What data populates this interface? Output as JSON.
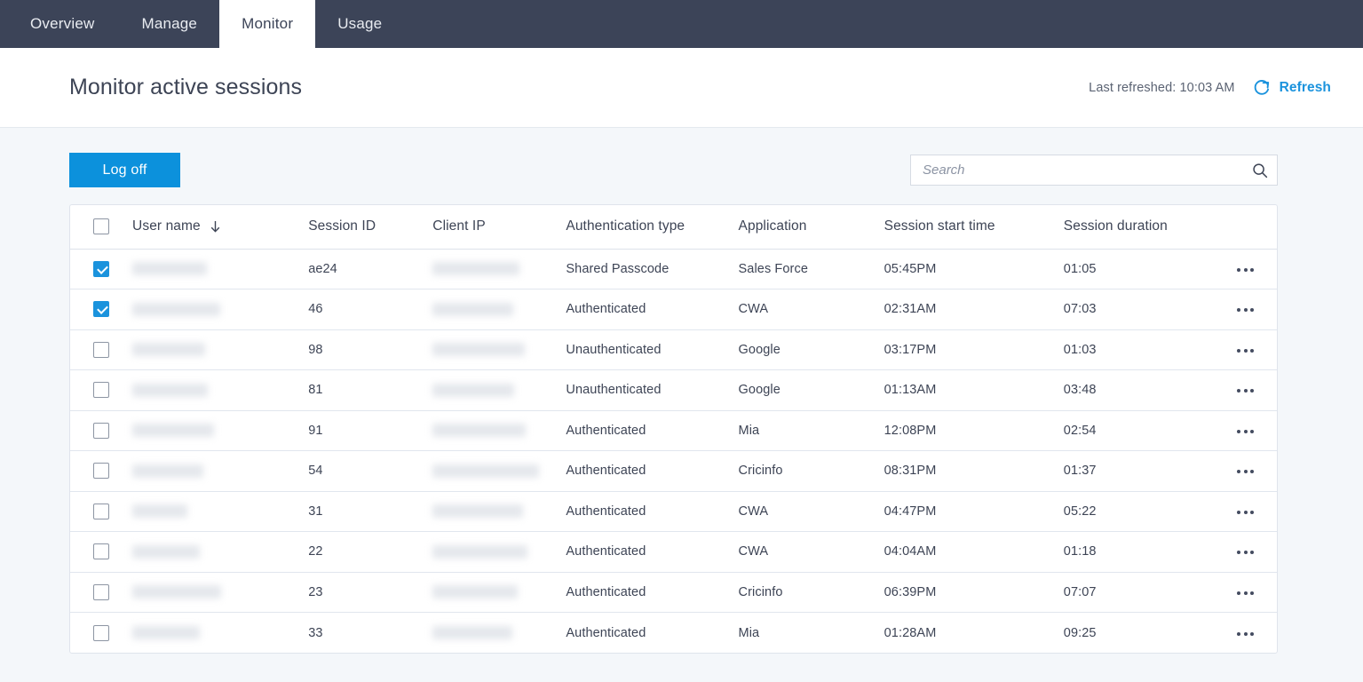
{
  "nav": {
    "tabs": [
      {
        "label": "Overview",
        "active": false
      },
      {
        "label": "Manage",
        "active": false
      },
      {
        "label": "Monitor",
        "active": true
      },
      {
        "label": "Usage",
        "active": false
      }
    ]
  },
  "header": {
    "title": "Monitor active sessions",
    "last_refreshed": "Last refreshed: 10:03 AM",
    "refresh_label": "Refresh",
    "refresh_icon": "refresh-circular-arrow-icon",
    "accent_color": "#1b93dd"
  },
  "toolbar": {
    "logoff_label": "Log off",
    "logoff_color": "#0c91dc",
    "search": {
      "placeholder": "Search",
      "value": "",
      "icon": "search-magnifier-icon"
    }
  },
  "table": {
    "select_all_checked": false,
    "sort_column": "User name",
    "sort_direction": "descending",
    "sort_icon": "arrow-down-icon",
    "row_menu_icon": "ellipsis-horizontal-icon",
    "columns": [
      "User name",
      "Session ID",
      "Client IP",
      "Authentication type",
      "Application",
      "Session start time",
      "Session duration"
    ],
    "rows": [
      {
        "selected": true,
        "user_name": "",
        "user_name_redacted": true,
        "user_redact_width": 84,
        "session_id": "ae24",
        "client_ip": "",
        "client_ip_redacted": true,
        "ip_redact_width": 98,
        "authentication_type": "Shared Passcode",
        "application": "Sales Force",
        "session_start_time": "05:45PM",
        "session_duration": "01:05"
      },
      {
        "selected": true,
        "user_name": "",
        "user_name_redacted": true,
        "user_redact_width": 99,
        "session_id": "46",
        "client_ip": "",
        "client_ip_redacted": true,
        "ip_redact_width": 91,
        "authentication_type": "Authenticated",
        "application": "CWA",
        "session_start_time": "02:31AM",
        "session_duration": "07:03"
      },
      {
        "selected": false,
        "user_name": "",
        "user_name_redacted": true,
        "user_redact_width": 82,
        "session_id": "98",
        "client_ip": "",
        "client_ip_redacted": true,
        "ip_redact_width": 104,
        "authentication_type": "Unauthenticated",
        "application": "Google",
        "session_start_time": "03:17PM",
        "session_duration": "01:03"
      },
      {
        "selected": false,
        "user_name": "",
        "user_name_redacted": true,
        "user_redact_width": 85,
        "session_id": "81",
        "client_ip": "",
        "client_ip_redacted": true,
        "ip_redact_width": 92,
        "authentication_type": "Unauthenticated",
        "application": "Google",
        "session_start_time": "01:13AM",
        "session_duration": "03:48"
      },
      {
        "selected": false,
        "user_name": "",
        "user_name_redacted": true,
        "user_redact_width": 92,
        "session_id": "91",
        "client_ip": "",
        "client_ip_redacted": true,
        "ip_redact_width": 105,
        "authentication_type": "Authenticated",
        "application": "Mia",
        "session_start_time": "12:08PM",
        "session_duration": "02:54"
      },
      {
        "selected": false,
        "user_name": "",
        "user_name_redacted": true,
        "user_redact_width": 80,
        "session_id": "54",
        "client_ip": "",
        "client_ip_redacted": true,
        "ip_redact_width": 120,
        "authentication_type": "Authenticated",
        "application": "Cricinfo",
        "session_start_time": "08:31PM",
        "session_duration": "01:37"
      },
      {
        "selected": false,
        "user_name": "",
        "user_name_redacted": true,
        "user_redact_width": 62,
        "session_id": "31",
        "client_ip": "",
        "client_ip_redacted": true,
        "ip_redact_width": 102,
        "authentication_type": "Authenticated",
        "application": "CWA",
        "session_start_time": "04:47PM",
        "session_duration": "05:22"
      },
      {
        "selected": false,
        "user_name": "",
        "user_name_redacted": true,
        "user_redact_width": 76,
        "session_id": "22",
        "client_ip": "",
        "client_ip_redacted": true,
        "ip_redact_width": 107,
        "authentication_type": "Authenticated",
        "application": "CWA",
        "session_start_time": "04:04AM",
        "session_duration": "01:18"
      },
      {
        "selected": false,
        "user_name": "",
        "user_name_redacted": true,
        "user_redact_width": 100,
        "session_id": "23",
        "client_ip": "",
        "client_ip_redacted": true,
        "ip_redact_width": 96,
        "authentication_type": "Authenticated",
        "application": "Cricinfo",
        "session_start_time": "06:39PM",
        "session_duration": "07:07"
      },
      {
        "selected": false,
        "user_name": "",
        "user_name_redacted": true,
        "user_redact_width": 76,
        "session_id": "33",
        "client_ip": "",
        "client_ip_redacted": true,
        "ip_redact_width": 90,
        "authentication_type": "Authenticated",
        "application": "Mia",
        "session_start_time": "01:28AM",
        "session_duration": "09:25"
      }
    ]
  }
}
